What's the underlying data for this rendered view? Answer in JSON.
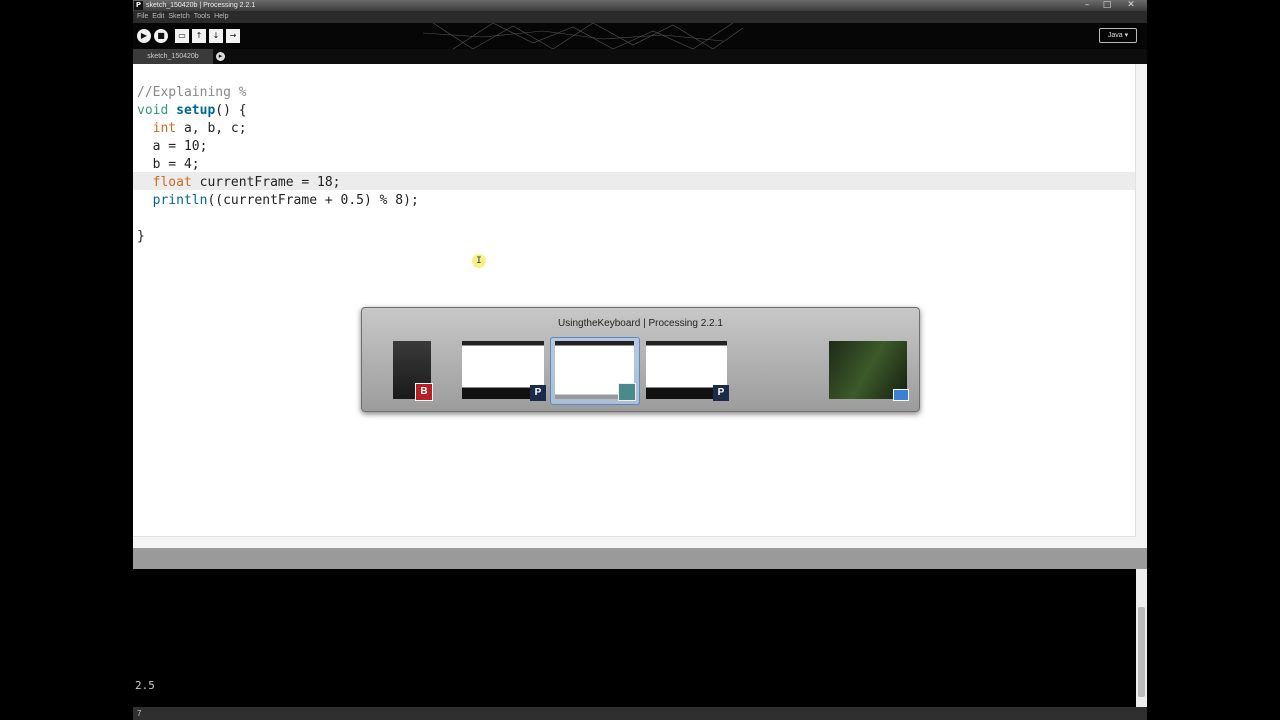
{
  "window": {
    "title": "sketch_150420b | Processing 2.2.1",
    "app_icon_letter": "P",
    "controls": {
      "minimize": "–",
      "maximize": "□",
      "close": "✕"
    }
  },
  "menu": [
    "File",
    "Edit",
    "Sketch",
    "Tools",
    "Help"
  ],
  "toolbar": {
    "buttons": [
      "run",
      "stop",
      "new",
      "open",
      "save",
      "export"
    ],
    "mode": "Java ▾"
  },
  "tabs": {
    "active": "sketch_150420b"
  },
  "editor": {
    "lines": [
      "//Explaining %",
      "void setup() {",
      "  int a, b, c;",
      "  a = 10;",
      "  b = 4;",
      "  float currentFrame = 18;",
      "  println((currentFrame + 0.5) % 8);",
      "",
      "}"
    ]
  },
  "console": {
    "output": "2.5"
  },
  "status": {
    "line": "7"
  },
  "switcher": {
    "title": "UsingtheKeyboard | Processing 2.2.1",
    "windows": [
      {
        "badge": "B",
        "icon": "bandicam-icon"
      },
      {
        "badge": "P",
        "icon": "processing-icon"
      },
      {
        "badge": "",
        "icon": "processing-window-icon"
      },
      {
        "badge": "P",
        "icon": "processing-icon"
      },
      {
        "badge": "",
        "icon": "desktop-icon"
      }
    ]
  },
  "colors": {
    "keyword_type": "#d06b1f",
    "keyword_func": "#006699",
    "comment": "#888888",
    "accent": "#5d86c4"
  }
}
